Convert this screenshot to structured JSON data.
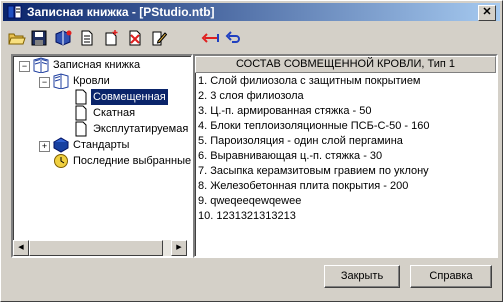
{
  "window": {
    "title": "Записная книжка - [PStudio.ntb]",
    "close_glyph": "✕"
  },
  "toolbar": {
    "buttons": [
      {
        "icon": "open-folder-icon"
      },
      {
        "icon": "save-disk-icon"
      },
      {
        "icon": "books-add-icon"
      },
      {
        "icon": "document-new-icon"
      },
      {
        "icon": "document-add-icon"
      },
      {
        "icon": "document-delete-icon"
      },
      {
        "icon": "document-edit-icon"
      },
      {
        "icon": "move-left-icon"
      },
      {
        "icon": "undo-icon"
      }
    ]
  },
  "tree": {
    "items": [
      {
        "label": "Записная книжка",
        "icon": "notebook-icon"
      },
      {
        "label": "Кровли",
        "icon": "book-icon"
      },
      {
        "label": "Совмещенная",
        "icon": "page-icon",
        "selected": true
      },
      {
        "label": "Скатная",
        "icon": "page-icon"
      },
      {
        "label": "Эксплутатируемая",
        "icon": "page-icon"
      },
      {
        "label": "Стандарты",
        "icon": "book-blue-icon"
      },
      {
        "label": "Последние выбранные",
        "icon": "clock-icon"
      }
    ],
    "expand_minus": "−",
    "expand_plus": "+",
    "scroll_left": "◀",
    "scroll_right": "▶"
  },
  "content": {
    "header": "СОСТАВ СОВМЕЩЕННОЙ КРОВЛИ, Тип 1",
    "lines": [
      "1. Слой филиозола с защитным покрытием",
      "2. 3 слоя филиозола",
      "3. Ц.-п. армированная стяжка - 50",
      "4. Блоки теплоизоляционные ПСБ-С-50 - 160",
      "5. Пароизоляция - один слой пергамина",
      "6. Выравнивающая ц.-п. стяжка - 30",
      "7. Засыпка керамзитовым гравием по уклону",
      "8. Железобетонная плита покрытия - 200",
      "9. qweqeeqewqewee",
      "10. 1231321313213"
    ]
  },
  "buttons": {
    "close_label": "Закрыть",
    "help_label": "Справка"
  },
  "colors": {
    "titlebar_start": "#0a246a",
    "titlebar_end": "#a6caf0",
    "selection": "#0a246a",
    "face": "#d4d0c8"
  }
}
